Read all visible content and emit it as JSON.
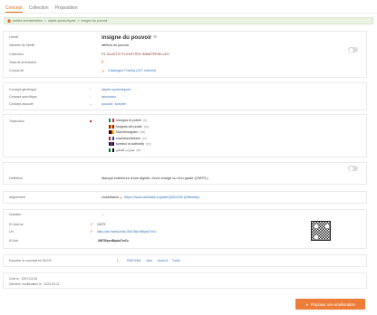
{
  "tabs": [
    "Concept",
    "Collection",
    "Proposition"
  ],
  "breadcrumb": [
    "entités immatérielles",
    "objets symboliques",
    "insigne du pouvoir"
  ],
  "main": {
    "labels": {
      "libelle": "Libellé",
      "variante": "Variante du libellé",
      "collection": "Collection",
      "total": "Total de la branche",
      "corpus": "Corpus lié"
    },
    "title": "insigne du pouvoir",
    "variante": "attribut du pouvoir",
    "collection": "P1-SUJETS P1-ENTITÉS IMMATÉRIELLES",
    "total": "[]",
    "corpus": "Catalogue Frantiq (327 notices)"
  },
  "relations": {
    "labels": {
      "generique": "Concept générique",
      "specifique": "Concept spécifique",
      "associe": "Concept associé"
    },
    "generique": "objets symboliques",
    "specifique": "faisceaux",
    "associe": "pouvoir; sceptre"
  },
  "translations": {
    "label": "Traduction",
    "items": [
      {
        "text": "insegna di potere",
        "lang": "(it)",
        "c1": "#009246",
        "c2": "#ffffff",
        "c3": "#ce2b37"
      },
      {
        "text": "insignia del poder",
        "lang": "(es)",
        "c1": "#aa151b",
        "c2": "#f1bf00",
        "c3": "#aa151b"
      },
      {
        "text": "Machtinsignien",
        "lang": "(de)",
        "c1": "#000000",
        "c2": "#dd0000",
        "c3": "#ffce00"
      },
      {
        "text": "machtsembleem",
        "lang": "(nl)",
        "c1": "#ae1c28",
        "c2": "#ffffff",
        "c3": "#21468b"
      },
      {
        "text": "symbol of authority",
        "lang": "(en)",
        "c1": "#012169",
        "c2": "#c8102e",
        "c3": "#012169"
      },
      {
        "text": "شارات الحكم",
        "lang": "(ar)",
        "c1": "#007a3d",
        "c2": "#ffffff",
        "c3": "#000000"
      }
    ]
  },
  "definition": {
    "label": "Définition",
    "text": "Marque extérieure d'une dignité, d'une charge ou d'un grade (CNRTL)."
  },
  "alignment": {
    "label": "Alignement",
    "prefix": "closeMatch :",
    "link": "https://www.wikidata.org/wiki/Q552345 (Wikidata)"
  },
  "notation": {
    "label": "Notation",
    "value": "..."
  },
  "ids": {
    "labels": {
      "internal": "ID interne",
      "uri": "Uri",
      "ark": "ID Ark"
    },
    "internal": "13279",
    "uri": "https://ark.frantiq.fr/ark:/26678/pcrt8kpkd7nrCc",
    "ark": "26678/pcrt8kpkd7nrCc"
  },
  "export": {
    "label": "Exporter le concept en SKOS",
    "formats": [
      "RDF/XML",
      "Json",
      "JsonLd",
      "Turtle"
    ]
  },
  "meta": {
    "created": "Créé le : 2007-02-06",
    "modified": "Dernière modification le : 2023-03-11"
  },
  "suggest_button": "Proposer une amélioration",
  "colors": {
    "accent": "#e56a1a",
    "button": "#ef7d3a",
    "link": "#3576b8",
    "breadcrumb_bg": "#eaf3e4"
  }
}
